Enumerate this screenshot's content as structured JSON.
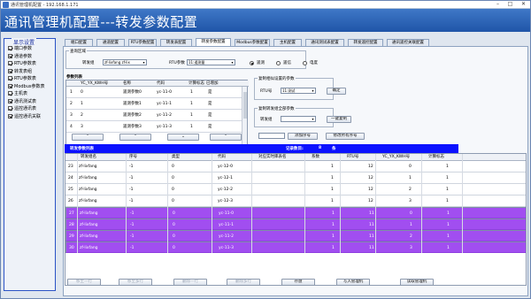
{
  "window": {
    "title": "通讯管理机配置 - 192.168.1.171"
  },
  "header": {
    "title": "通讯管理机配置---转发参数配置"
  },
  "sidebar": {
    "title": "显示设置",
    "items": [
      {
        "label": "端口参数",
        "checked": true
      },
      {
        "label": "通道参数",
        "checked": true
      },
      {
        "label": "RTU参数表",
        "checked": true
      },
      {
        "label": "转发表组",
        "checked": true
      },
      {
        "label": "RTU参数表",
        "checked": true
      },
      {
        "label": "Modbus参数表",
        "checked": true
      },
      {
        "label": "主机表",
        "checked": true
      },
      {
        "label": "通讯测试表",
        "checked": true
      },
      {
        "label": "遥控通讯表",
        "checked": true
      },
      {
        "label": "遥控通讯关联",
        "checked": true
      }
    ]
  },
  "tabs": [
    {
      "label": "端口配置",
      "active": false
    },
    {
      "label": "通道配置",
      "active": false
    },
    {
      "label": "RTU参数配置",
      "active": false
    },
    {
      "label": "转发表配置",
      "active": false
    },
    {
      "label": "转发参数配置",
      "active": true
    },
    {
      "label": "Modbus参数配置",
      "active": false
    },
    {
      "label": "主机配置",
      "active": false
    },
    {
      "label": "通讯测试表配置",
      "active": false
    },
    {
      "label": "转发遥控配置",
      "active": false
    },
    {
      "label": "通讯遥控关联配置",
      "active": false
    }
  ],
  "query": {
    "group_title": "查询区域",
    "forward_label": "转发组",
    "forward_value": "zf-lixfang zf-lix",
    "rtu_label": "RTU参数",
    "rtu_value": "11:遥测量",
    "radios": [
      {
        "label": "遥测",
        "checked": true
      },
      {
        "label": "遥信",
        "checked": false
      },
      {
        "label": "电度",
        "checked": false
      }
    ]
  },
  "param_list": {
    "title": "参数列表",
    "headers": [
      "YC_YX_KWH号",
      "名称",
      "代码",
      "计算标志",
      "已增加"
    ],
    "rows": [
      {
        "no": "1",
        "id": "0",
        "name": "遥测参数0",
        "code": "yc-11-0",
        "flag": "1",
        "added": "是"
      },
      {
        "no": "2",
        "id": "1",
        "name": "遥测参数1",
        "code": "yc-11-1",
        "flag": "1",
        "added": "是"
      },
      {
        "no": "3",
        "id": "2",
        "name": "遥测参数2",
        "code": "yc-11-2",
        "flag": "1",
        "added": "是"
      },
      {
        "no": "4",
        "id": "3",
        "name": "遥测参数3",
        "code": "yc-11-3",
        "flag": "1",
        "added": "是"
      }
    ]
  },
  "copy_section": {
    "title": "复制相似设置的参数",
    "rtu_label": "RTU号",
    "rtu_value": "11:测试",
    "confirm_label": "确定"
  },
  "copy_forward_section": {
    "title": "复制转发组全部参数",
    "forward_label": "转发组",
    "forward_value": "",
    "copy_label": "一键复制"
  },
  "arrow_buttons": [
    "⌃",
    "⌃",
    "⌄",
    "⌃"
  ],
  "mid_buttons": {
    "add_seq": "添加序号",
    "modify_seq": "修改所有序号"
  },
  "forward_table": {
    "title": "转发参数列表",
    "record_label": "记录数目:",
    "record_count": "8",
    "record_unit": "条",
    "headers": [
      "转发组名",
      "序号",
      "类型",
      "代码",
      "对应实时库表名",
      "系数",
      "RTU号",
      "YC_YX_KWH号",
      "计算标志"
    ],
    "rows": [
      {
        "n": "23",
        "group": "zf-lixfang",
        "seq": "-1",
        "type": "0",
        "code": "yc-12-0",
        "table": "",
        "coef": "1",
        "rtu": "12",
        "yid": "0",
        "flag": "1",
        "selected": false
      },
      {
        "n": "24",
        "group": "zf-lixfang",
        "seq": "-1",
        "type": "0",
        "code": "yc-12-1",
        "table": "",
        "coef": "1",
        "rtu": "12",
        "yid": "1",
        "flag": "1",
        "selected": false
      },
      {
        "n": "25",
        "group": "zf-lixfang",
        "seq": "-1",
        "type": "0",
        "code": "yc-12-2",
        "table": "",
        "coef": "1",
        "rtu": "12",
        "yid": "2",
        "flag": "1",
        "selected": false
      },
      {
        "n": "26",
        "group": "zf-lixfang",
        "seq": "-1",
        "type": "0",
        "code": "yc-12-3",
        "table": "",
        "coef": "1",
        "rtu": "12",
        "yid": "3",
        "flag": "1",
        "selected": false
      },
      {
        "n": "27",
        "group": "zf-lixfang",
        "seq": "-1",
        "type": "0",
        "code": "yc-11-0",
        "table": "",
        "coef": "1",
        "rtu": "11",
        "yid": "0",
        "flag": "1",
        "selected": true
      },
      {
        "n": "28",
        "group": "zf-lixfang",
        "seq": "-1",
        "type": "0",
        "code": "yc-11-1",
        "table": "",
        "coef": "1",
        "rtu": "11",
        "yid": "1",
        "flag": "1",
        "selected": true
      },
      {
        "n": "29",
        "group": "zf-lixfang",
        "seq": "-1",
        "type": "0",
        "code": "yc-11-2",
        "table": "",
        "coef": "1",
        "rtu": "11",
        "yid": "2",
        "flag": "1",
        "selected": true
      },
      {
        "n": "30",
        "group": "zf-lixfang",
        "seq": "-1",
        "type": "0",
        "code": "yc-11-3",
        "table": "",
        "coef": "1",
        "rtu": "11",
        "yid": "3",
        "flag": "1",
        "selected": true
      }
    ]
  },
  "bottom_buttons": [
    {
      "label": "移至一行",
      "disabled": true
    },
    {
      "label": "移至多行",
      "disabled": true
    },
    {
      "label": "删除一行",
      "disabled": true
    },
    {
      "label": "删除多行",
      "disabled": true
    },
    {
      "label": "存盘",
      "disabled": false
    },
    {
      "label": "写入管理机",
      "disabled": false
    },
    {
      "label": "读取管理机",
      "disabled": false
    }
  ],
  "colors": {
    "header": "#2a63b8",
    "selected_row": "#a14ef0",
    "list_bar": "#0b11ff"
  }
}
